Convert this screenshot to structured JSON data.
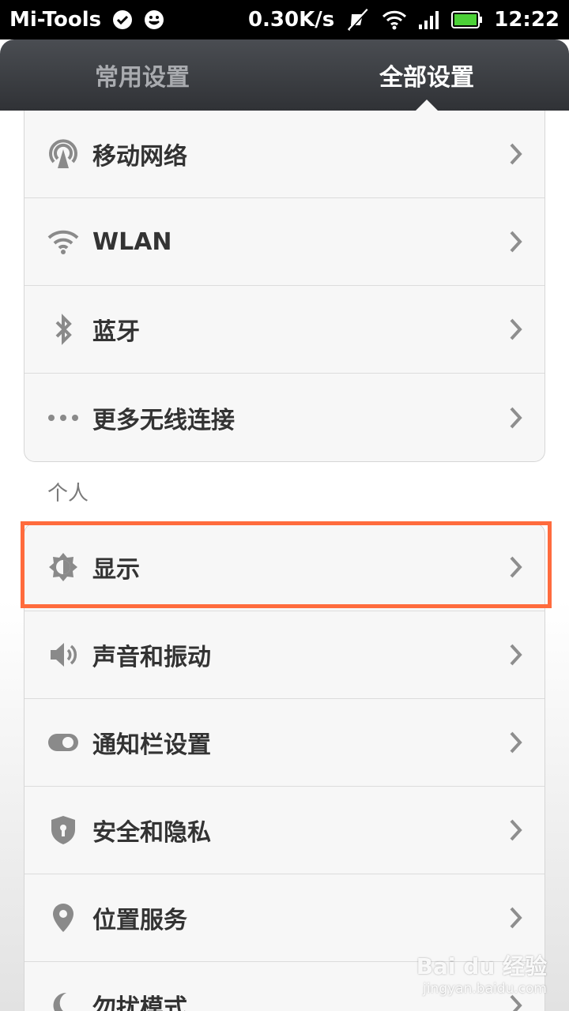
{
  "status_bar": {
    "app_name": "Mi-Tools",
    "speed": "0.30K/s",
    "time": "12:22",
    "icons": [
      "check-circle-icon",
      "smiley-icon",
      "muted-notification-icon",
      "wifi-icon",
      "signal-icon",
      "battery-icon"
    ]
  },
  "tabs": [
    {
      "label": "常用设置",
      "active": false
    },
    {
      "label": "全部设置",
      "active": true
    }
  ],
  "wireless_items": [
    {
      "label": "移动网络",
      "icon": "mobile-network-icon"
    },
    {
      "label": "WLAN",
      "icon": "wifi-icon"
    },
    {
      "label": "蓝牙",
      "icon": "bluetooth-icon"
    },
    {
      "label": "更多无线连接",
      "icon": "more-dots-icon"
    }
  ],
  "personal": {
    "header": "个人",
    "items": [
      {
        "label": "显示",
        "icon": "display-brightness-icon",
        "highlighted": true
      },
      {
        "label": "声音和振动",
        "icon": "speaker-icon"
      },
      {
        "label": "通知栏设置",
        "icon": "toggle-icon"
      },
      {
        "label": "安全和隐私",
        "icon": "shield-icon"
      },
      {
        "label": "位置服务",
        "icon": "location-pin-icon"
      },
      {
        "label": "勿扰模式",
        "icon": "moon-icon"
      }
    ]
  },
  "watermark": {
    "brand": "Bai du 经验",
    "url": "jingyan.baidu.com"
  },
  "colors": {
    "highlight": "#ff6b3d",
    "tabbar": "#3a3c40"
  }
}
